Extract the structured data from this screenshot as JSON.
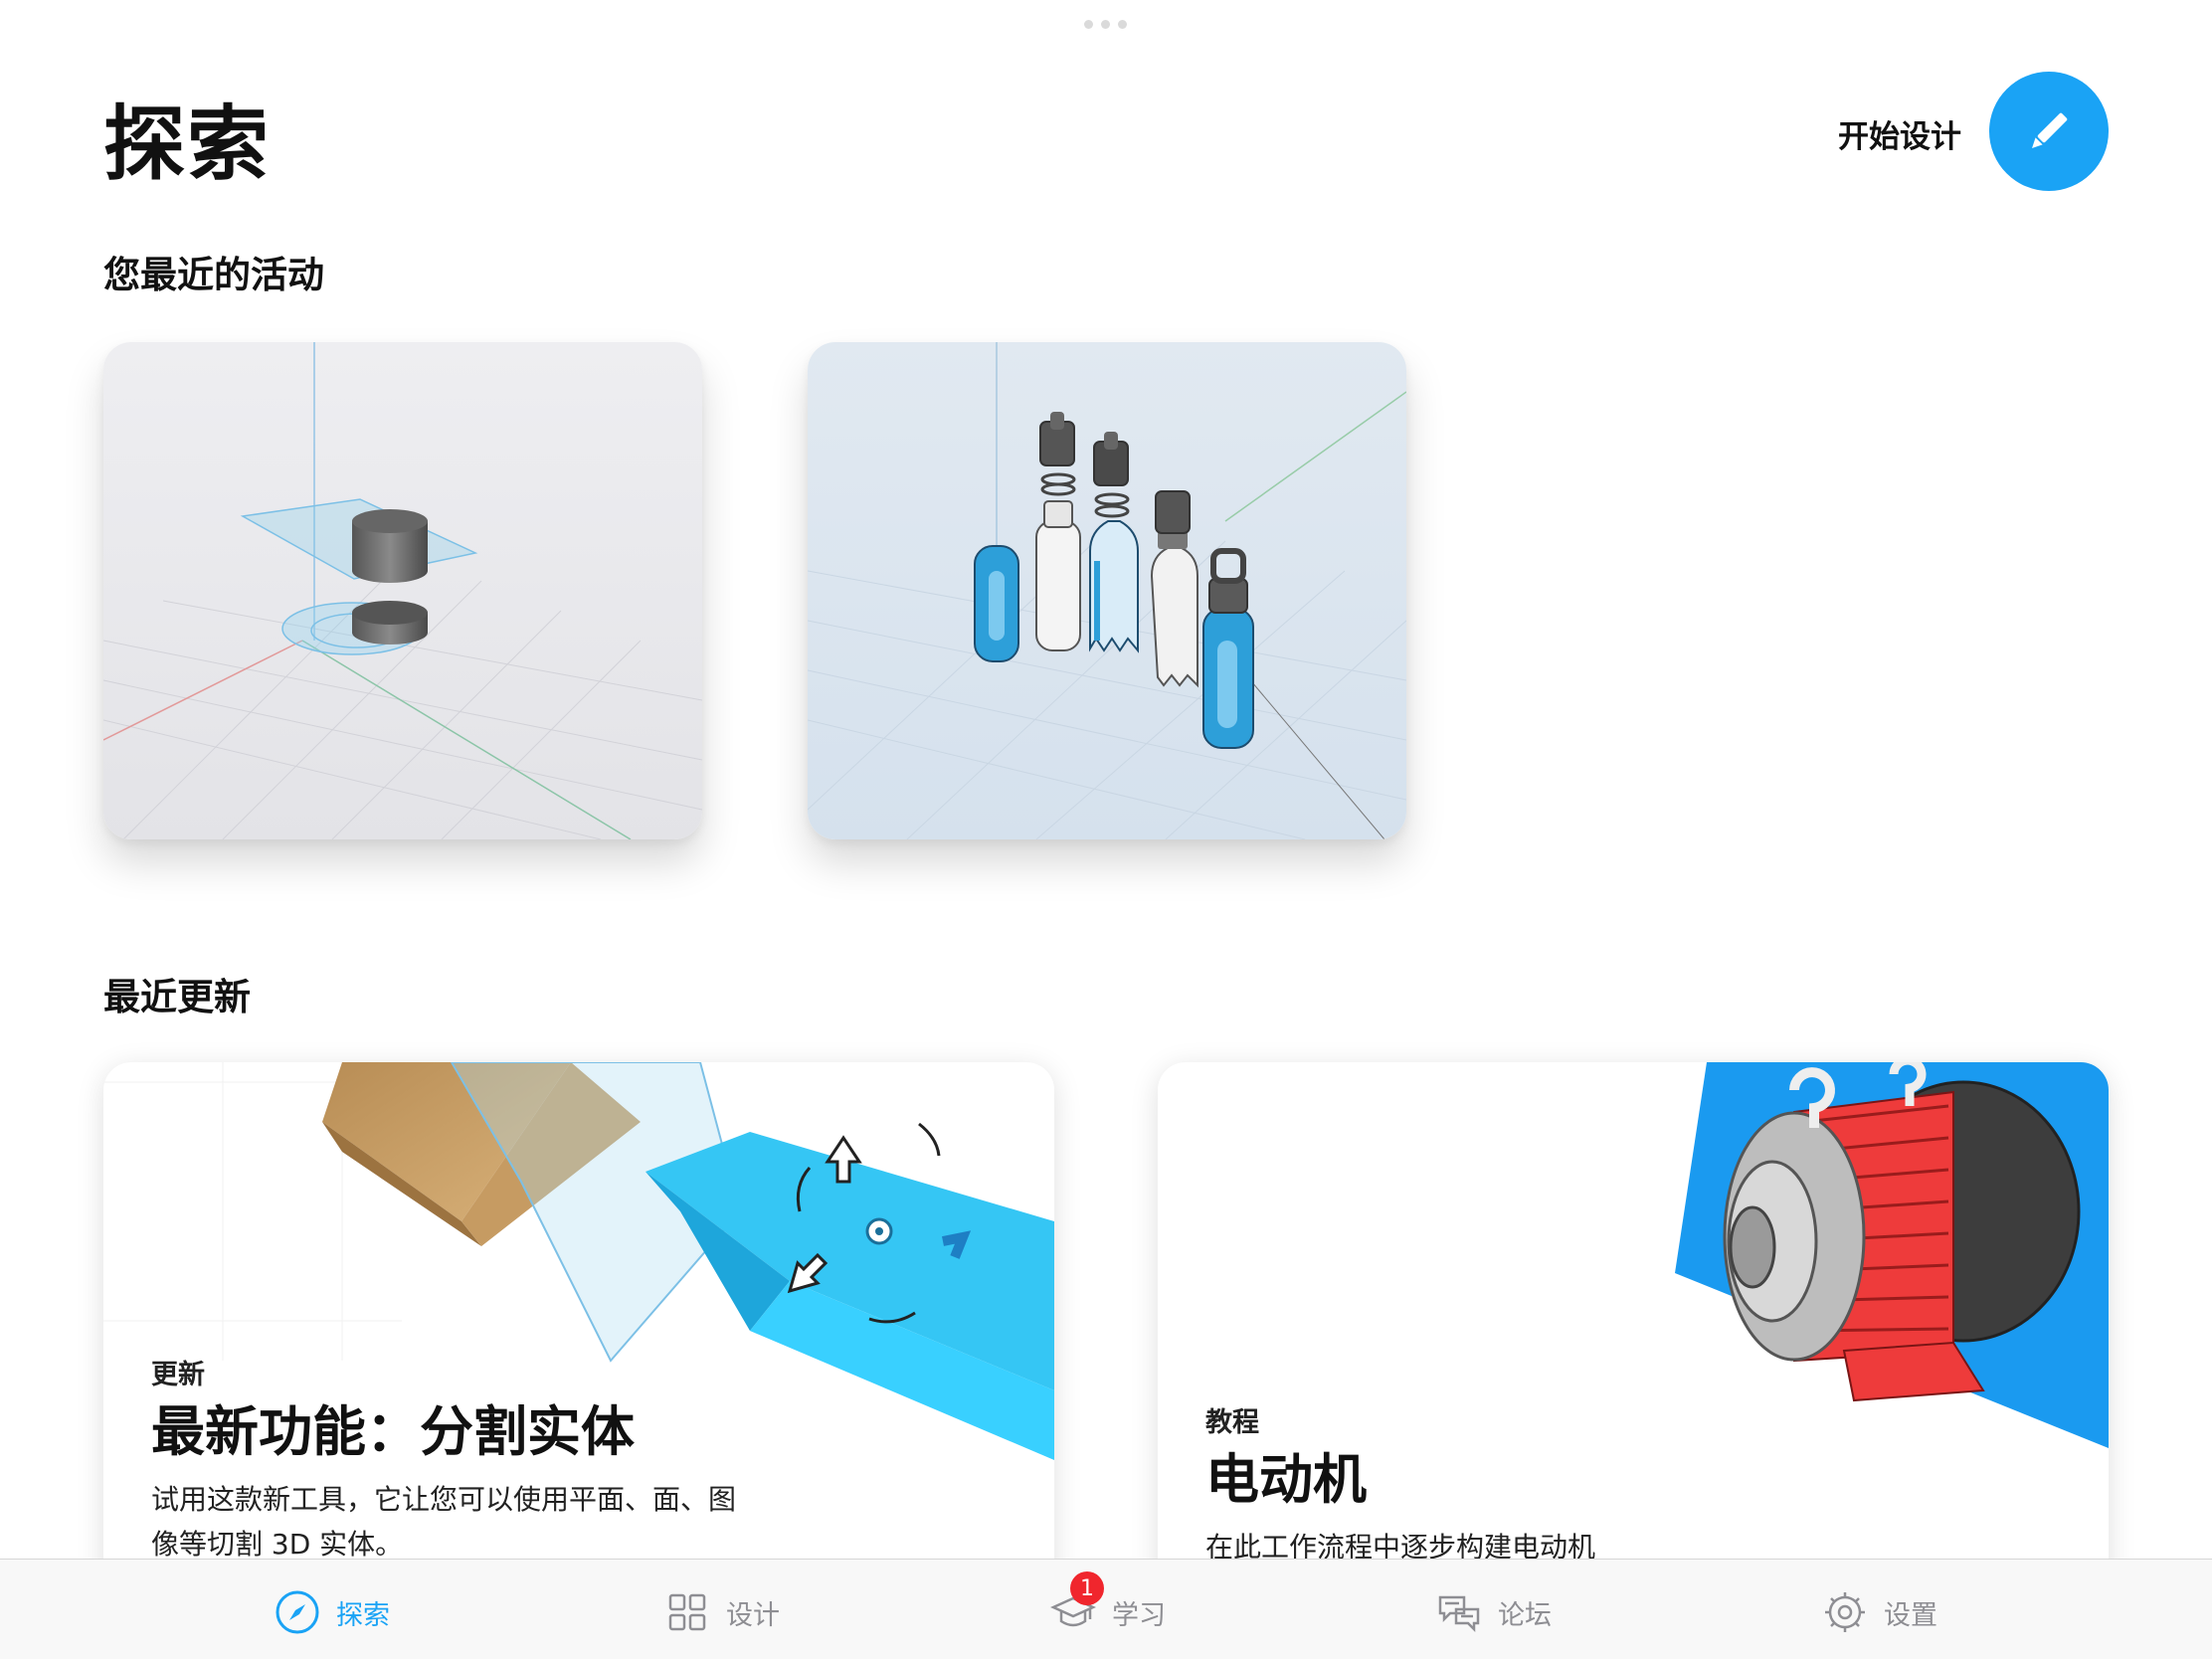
{
  "header": {
    "title": "探索",
    "start_design_label": "开始设计",
    "start_design_icon": "pencil-icon"
  },
  "recent_activity": {
    "title": "您最近的活动",
    "items": [
      {
        "thumbnail": "cylinder-split-model-thumbnail"
      },
      {
        "thumbnail": "water-bottles-model-thumbnail"
      }
    ]
  },
  "recent_updates": {
    "title": "最近更新",
    "cards": [
      {
        "category": "更新",
        "title": "最新功能：分割实体",
        "description": "试用这款新工具，它让您可以使用平面、面、图像等切割 3D 实体。",
        "image": "split-body-illustration"
      },
      {
        "category": "教程",
        "title": "电动机",
        "description": "在此工作流程中逐步构建电动机",
        "image": "electric-motor-illustration"
      }
    ]
  },
  "tabbar": {
    "tabs": [
      {
        "label": "探索",
        "icon": "compass-icon",
        "active": true
      },
      {
        "label": "设计",
        "icon": "grid-icon",
        "active": false
      },
      {
        "label": "学习",
        "icon": "graduation-cap-icon",
        "active": false,
        "badge": "1"
      },
      {
        "label": "论坛",
        "icon": "chat-bubbles-icon",
        "active": false
      },
      {
        "label": "设置",
        "icon": "gear-icon",
        "active": false
      }
    ]
  },
  "colors": {
    "accent": "#1aa3f5",
    "badge": "#f0262d",
    "inactive_tab": "#8e8e93"
  }
}
